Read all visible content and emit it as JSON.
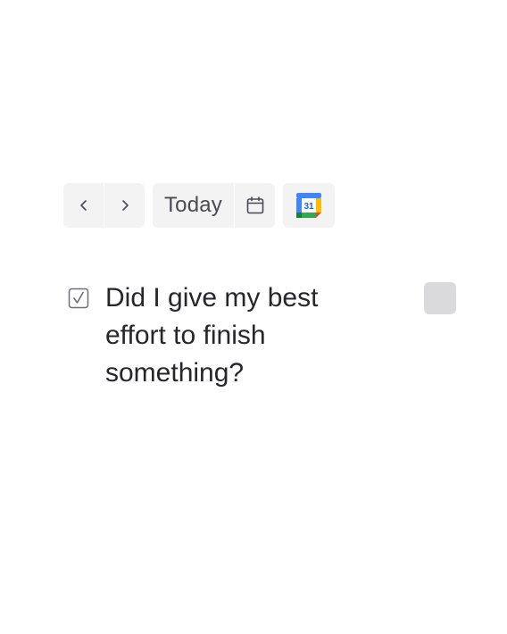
{
  "toolbar": {
    "prev_icon": "chevron-left-icon",
    "next_icon": "chevron-right-icon",
    "today_label": "Today",
    "calendar_icon": "calendar-icon",
    "google_calendar_icon": "google-calendar-icon",
    "google_calendar_day": "31"
  },
  "prompt": {
    "checkbox_icon": "checkbox-checked-icon",
    "text": "Did I give my best effort to finish something?"
  },
  "colors": {
    "button_bg": "#f3f3f4",
    "text": "#26262b",
    "square_button_bg": "#dadadc",
    "gcal_blue": "#4285f4",
    "gcal_green": "#34a853",
    "gcal_yellow": "#fbbc04",
    "gcal_red": "#ea4335"
  }
}
